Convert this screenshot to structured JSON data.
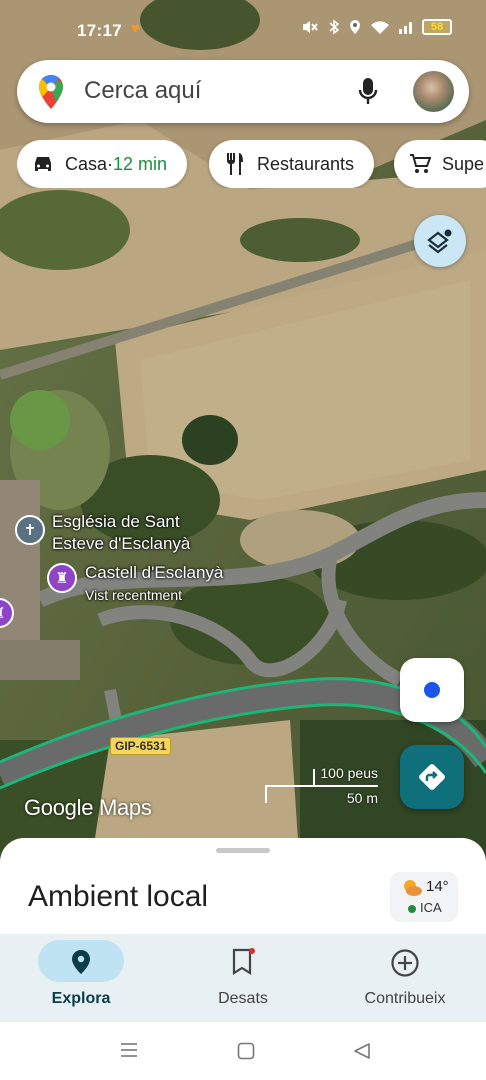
{
  "status_bar": {
    "time": "17:17",
    "battery": "58"
  },
  "search": {
    "placeholder": "Cerca aquí"
  },
  "chips": [
    {
      "label": "Casa",
      "separator": " · ",
      "extra": "12 min",
      "icon": "car-icon"
    },
    {
      "label": "Restaurants",
      "icon": "restaurant-icon"
    },
    {
      "label": "Supe",
      "icon": "cart-icon"
    }
  ],
  "map": {
    "poi_church": {
      "line1": "Església de Sant",
      "line2": "Esteve d'Esclanyà"
    },
    "poi_castle": {
      "name": "Castell d'Esclanyà",
      "sub": "Vist recentment"
    },
    "road_label": "GIP-6531",
    "scale_top": "100 peus",
    "scale_bottom": "50 m",
    "watermark": "Google Maps"
  },
  "sheet": {
    "title": "Ambient local",
    "weather_temp": "14°",
    "weather_aqi": "ICA"
  },
  "nav": {
    "items": [
      {
        "label": "Explora",
        "icon": "explore-pin-icon",
        "active": true
      },
      {
        "label": "Desats",
        "icon": "bookmark-icon",
        "active": false
      },
      {
        "label": "Contribueix",
        "icon": "add-circle-icon",
        "active": false
      }
    ]
  },
  "colors": {
    "accent": "#0f6f7a",
    "location_dot": "#1a56e8",
    "nav_active_pill": "#bfe3f3",
    "eta_green": "#1e8e3e"
  }
}
